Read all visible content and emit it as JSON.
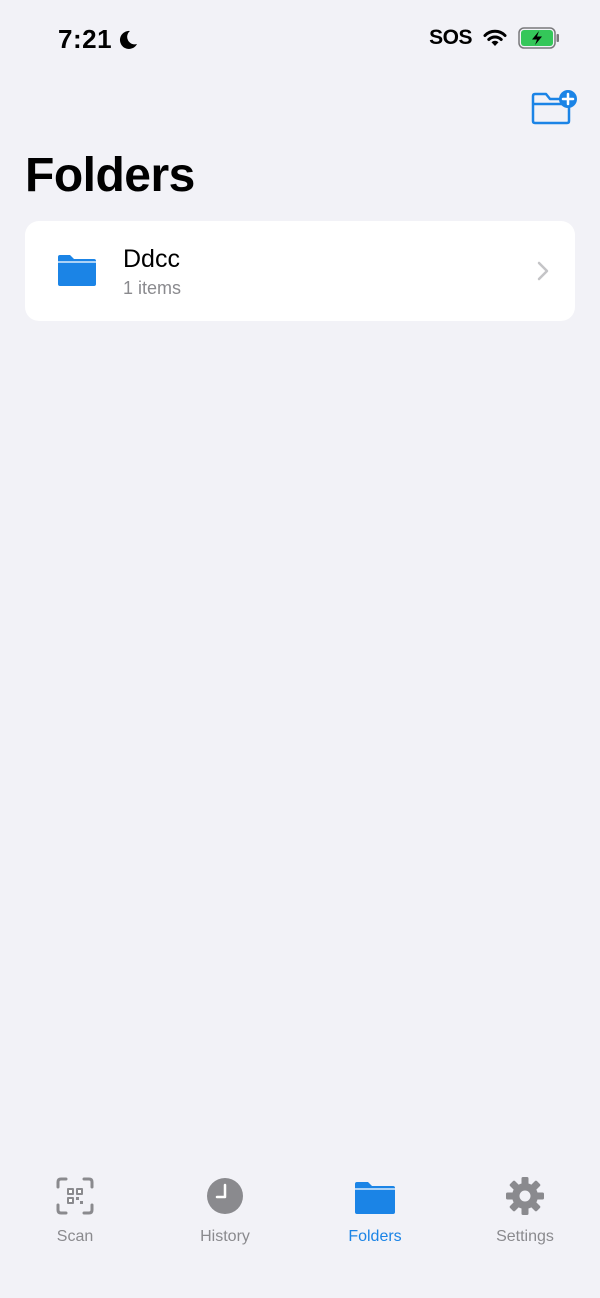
{
  "status_bar": {
    "time": "7:21",
    "sos": "SOS",
    "icons": [
      "moon-icon",
      "wifi-icon",
      "battery-charging-icon"
    ]
  },
  "header": {
    "title": "Folders",
    "action_icon": "new-folder-icon"
  },
  "folders": [
    {
      "name": "Ddcc",
      "count": "1 items",
      "icon": "folder-icon"
    }
  ],
  "tab_bar": {
    "tabs": [
      {
        "label": "Scan",
        "icon": "qr-scan-icon",
        "active": false
      },
      {
        "label": "History",
        "icon": "clock-icon",
        "active": false
      },
      {
        "label": "Folders",
        "icon": "folder-icon",
        "active": true
      },
      {
        "label": "Settings",
        "icon": "gear-icon",
        "active": false
      }
    ]
  },
  "colors": {
    "accent": "#1b84e6",
    "background": "#f2f2f7",
    "card": "#ffffff",
    "inactive": "#8a8a8e",
    "battery": "#34c759"
  }
}
